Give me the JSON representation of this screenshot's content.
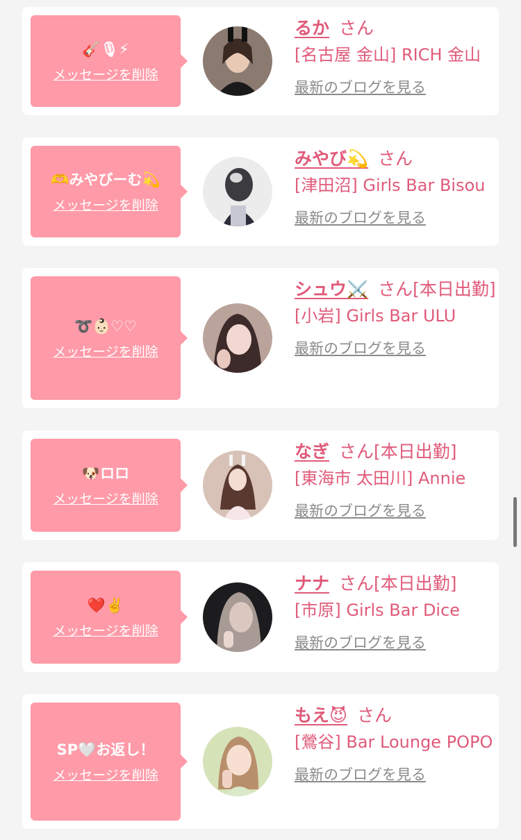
{
  "delete_label": "メッセージを削除",
  "san_label": "さん",
  "blog_label": "最新のブログを見る",
  "accent_color": "#e05a79",
  "bubble_color": "#ff9aa8",
  "cards": [
    {
      "message": "🎸🎙⚡",
      "name": "るか",
      "status": "",
      "shop": "[名古屋 金山] RICH 金山"
    },
    {
      "message": "🫶みやびーむ💫",
      "name": "みやび💫",
      "status": "",
      "shop": "[津田沼] Girls Bar Bisou"
    },
    {
      "message": "➰👶🏻♡♡",
      "name": "シュウ⚔️",
      "status": "[本日出勤]",
      "shop": "[小岩] Girls Bar ULU"
    },
    {
      "message": "🐶ロロ",
      "name": "なぎ",
      "status": "[本日出勤]",
      "shop": "[東海市 太田川] Annie"
    },
    {
      "message": "❤️✌️",
      "name": "ナナ",
      "status": "[本日出勤]",
      "shop": "[市原] Girls Bar Dice"
    },
    {
      "message": "SP🤍お返し！",
      "name": "もえ😈",
      "status": "",
      "shop": "[鶯谷] Bar Lounge POPO"
    }
  ]
}
